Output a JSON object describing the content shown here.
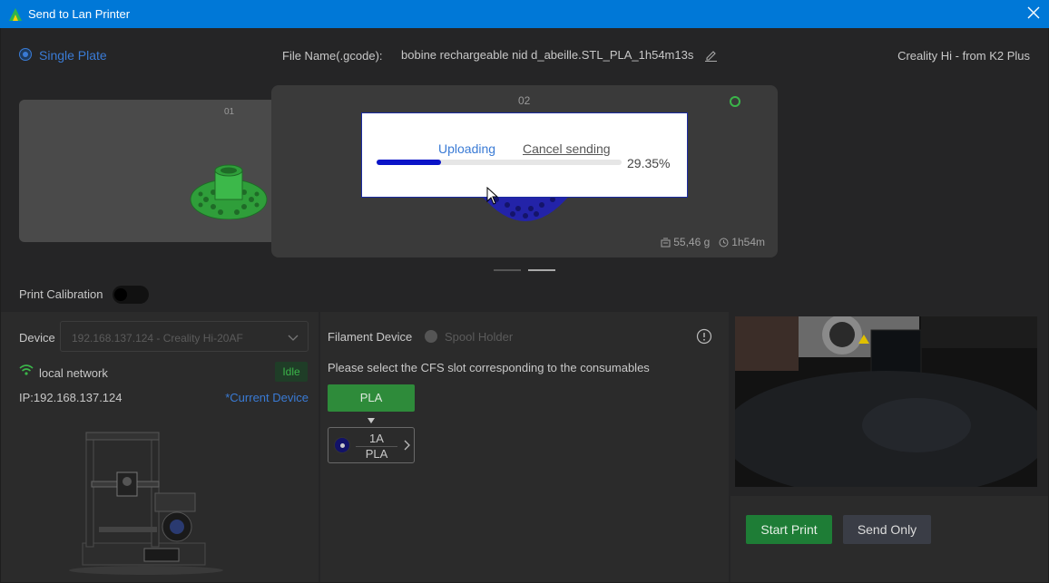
{
  "window": {
    "title": "Send to Lan Printer",
    "accent": "#0078d7"
  },
  "header": {
    "plate_mode": "Single Plate",
    "file_label": "File Name(.gcode):",
    "file_name": "bobine rechargeable nid d_abeille.STL_PLA_1h54m13s",
    "printer_name": "Creality Hi - from K2 Plus"
  },
  "plates": [
    {
      "number": "01",
      "model_color": "#3bb54a"
    },
    {
      "number": "02",
      "model_color": "#2a2ab8",
      "weight": "55,46 g",
      "time": "1h54m"
    }
  ],
  "upload": {
    "status": "Uploading",
    "cancel_label": "Cancel sending",
    "progress": 0.2635,
    "percent_label": "29.35%"
  },
  "calibration": {
    "label": "Print Calibration",
    "enabled": false
  },
  "device": {
    "label": "Device",
    "selected": "192.168.137.124 - Creality Hi-20AF",
    "network": "local network",
    "status": "Idle",
    "ip": "IP:192.168.137.124",
    "current_label": "*Current Device"
  },
  "filament": {
    "label": "Filament Device",
    "spool_holder": "Spool Holder",
    "hint": "Please select the CFS slot corresponding to the consumables",
    "material_button": "PLA",
    "slot": {
      "id": "1A",
      "material": "PLA",
      "color": "#121268"
    }
  },
  "actions": {
    "start_print": "Start Print",
    "send_only": "Send Only"
  }
}
